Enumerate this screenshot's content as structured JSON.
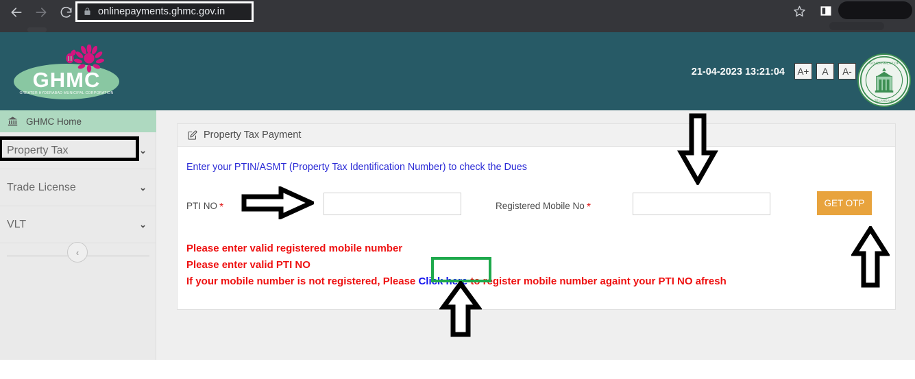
{
  "browser": {
    "back_icon": "back-arrow-icon",
    "forward_icon": "forward-arrow-icon",
    "reload_icon": "reload-icon",
    "lock_icon": "lock-icon",
    "url": "onlinepayments.ghmc.gov.in",
    "bookmark_icon": "star-icon",
    "side_panel_icon": "side-panel-icon"
  },
  "header": {
    "logo_text": "GHMC",
    "logo_subtitle": "GREATER HYDERABAD MUNICIPAL CORPORATION",
    "datetime": "21-04-2023 13:21:04",
    "font_buttons": [
      "A+",
      "A",
      "A-"
    ],
    "emblem_alt": "Government of Telangana emblem",
    "teal": "#275a66",
    "logo_green": "#89c7a2",
    "flower_pink": "#d4157f"
  },
  "sidebar": {
    "home_label": "GHMC Home",
    "home_icon": "bank-icon",
    "items": [
      {
        "label": "Property Tax",
        "chevron": "⌄"
      },
      {
        "label": "Trade License",
        "chevron": "⌄"
      },
      {
        "label": "VLT",
        "chevron": "⌄"
      }
    ],
    "collapse_icon": "‹"
  },
  "panel": {
    "title": "Property Tax Payment",
    "title_icon": "edit-square-icon",
    "instruction": "Enter your PTIN/ASMT (Property Tax Identification Number) to check the Dues",
    "form": {
      "pti_label": "PTI NO",
      "pti_required": "*",
      "pti_value": "",
      "pti_placeholder": "",
      "mobile_label": "Registered Mobile No",
      "mobile_required": "*",
      "mobile_value": "",
      "mobile_placeholder": "",
      "otp_button": "GET OTP",
      "otp_color": "#e8a33d"
    },
    "errors": [
      "Please enter valid registered mobile number",
      "Please enter valid PTI NO"
    ],
    "error_link_line": {
      "before": "If your mobile number is not registered, Please ",
      "link": "Click here",
      "after": " to register mobile number againt your PTI NO afresh"
    },
    "error_color": "#ee1111",
    "link_color": "#1414ee"
  },
  "annotations": {
    "property_tax_box_color": "#000000",
    "click_here_box_color": "#1ea94c",
    "arrow_color": "#000000",
    "arrows": [
      {
        "name": "arrow-right-to-pti-input",
        "direction": "right"
      },
      {
        "name": "arrow-down-to-mobile-input",
        "direction": "down"
      },
      {
        "name": "arrow-up-to-get-otp",
        "direction": "up"
      },
      {
        "name": "arrow-up-to-click-here",
        "direction": "up"
      }
    ]
  }
}
